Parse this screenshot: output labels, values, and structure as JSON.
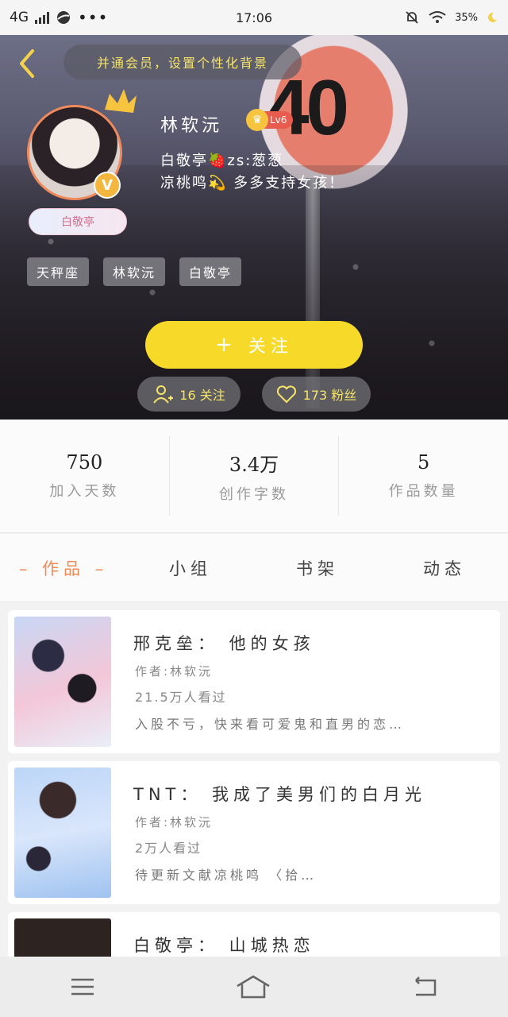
{
  "status_bar": {
    "network": "4G",
    "time": "17:06",
    "battery": "35%"
  },
  "header": {
    "background_tip": "并通会员，设置个性化背景"
  },
  "profile": {
    "avatar_tag": "白敬亭",
    "name": "林软沅",
    "level": "Lv6",
    "bio_line1": "白敬亭🍓zs:葱葱",
    "bio_line2": "凉桃鸣💫 多多支持女孩！",
    "tags": [
      "天秤座",
      "林软沅",
      "白敬亭"
    ],
    "follow_label": "关注",
    "follow_count": "16 关注",
    "fans_count": "173 粉丝"
  },
  "stats": [
    {
      "value": "750",
      "label": "加入天数"
    },
    {
      "value": "3.4万",
      "label": "创作字数"
    },
    {
      "value": "5",
      "label": "作品数量"
    }
  ],
  "tabs": [
    {
      "label": "作品",
      "active": true
    },
    {
      "label": "小组",
      "active": false
    },
    {
      "label": "书架",
      "active": false
    },
    {
      "label": "动态",
      "active": false
    }
  ],
  "works": [
    {
      "title": "邢克垒： 他的女孩",
      "author": "作者:林软沅",
      "views": "21.5万人看过",
      "desc": "入股不亏，快来看可爱鬼和直男的恋…"
    },
    {
      "title": "TNT： 我成了美男们的白月光",
      "author": "作者:林软沅",
      "views": "2万人看过",
      "desc": "待更新文献凉桃鸣 〈拾…"
    },
    {
      "title": "白敬亭： 山城热恋",
      "author": "",
      "views": "",
      "desc": ""
    }
  ],
  "colors": {
    "accent": "#ef8a55",
    "follow_button": "#f7d92a",
    "level_badge": "#e85b4f"
  }
}
